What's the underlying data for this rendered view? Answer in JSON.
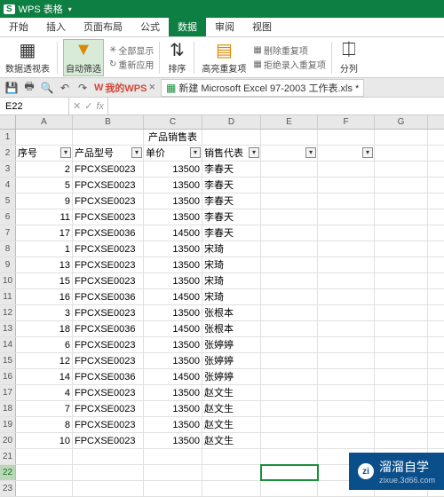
{
  "titlebar": {
    "badge": "S",
    "title": "WPS 表格"
  },
  "tabs": [
    "开始",
    "插入",
    "页面布局",
    "公式",
    "数据",
    "审阅",
    "视图"
  ],
  "active_tab": 4,
  "ribbon": {
    "pivot": "数据透视表",
    "autofilter": "自动筛选",
    "showall": "全部显示",
    "reapply": "重新应用",
    "sort": "排序",
    "highlight_dup": "高亮重复项",
    "remove_dup": "删除重复项",
    "reject_dup": "拒绝录入重复项",
    "split": "分列"
  },
  "qat": {
    "mywps": "我的WPS",
    "doc": "新建 Microsoft Excel 97-2003 工作表.xls *"
  },
  "namebox": "E22",
  "columns": [
    "A",
    "B",
    "C",
    "D",
    "E",
    "F",
    "G"
  ],
  "title_row": "产品销售表",
  "headers": [
    "序号",
    "产品型号",
    "单价",
    "销售代表"
  ],
  "rows": [
    {
      "n": 2,
      "model": "FPCXSE0023",
      "price": 13500,
      "rep": "李春天"
    },
    {
      "n": 5,
      "model": "FPCXSE0023",
      "price": 13500,
      "rep": "李春天"
    },
    {
      "n": 9,
      "model": "FPCXSE0023",
      "price": 13500,
      "rep": "李春天"
    },
    {
      "n": 11,
      "model": "FPCXSE0023",
      "price": 13500,
      "rep": "李春天"
    },
    {
      "n": 17,
      "model": "FPCXSE0036",
      "price": 14500,
      "rep": "李春天"
    },
    {
      "n": 1,
      "model": "FPCXSE0023",
      "price": 13500,
      "rep": "宋琦"
    },
    {
      "n": 13,
      "model": "FPCXSE0023",
      "price": 13500,
      "rep": "宋琦"
    },
    {
      "n": 15,
      "model": "FPCXSE0023",
      "price": 13500,
      "rep": "宋琦"
    },
    {
      "n": 16,
      "model": "FPCXSE0036",
      "price": 14500,
      "rep": "宋琦"
    },
    {
      "n": 3,
      "model": "FPCXSE0023",
      "price": 13500,
      "rep": "张根本"
    },
    {
      "n": 18,
      "model": "FPCXSE0036",
      "price": 14500,
      "rep": "张根本"
    },
    {
      "n": 6,
      "model": "FPCXSE0023",
      "price": 13500,
      "rep": "张婷婷"
    },
    {
      "n": 12,
      "model": "FPCXSE0023",
      "price": 13500,
      "rep": "张婷婷"
    },
    {
      "n": 14,
      "model": "FPCXSE0036",
      "price": 14500,
      "rep": "张婷婷"
    },
    {
      "n": 4,
      "model": "FPCXSE0023",
      "price": 13500,
      "rep": "赵文生"
    },
    {
      "n": 7,
      "model": "FPCXSE0023",
      "price": 13500,
      "rep": "赵文生"
    },
    {
      "n": 8,
      "model": "FPCXSE0023",
      "price": 13500,
      "rep": "赵文生"
    },
    {
      "n": 10,
      "model": "FPCXSE0023",
      "price": 13500,
      "rep": "赵文生"
    }
  ],
  "selected_row": 22,
  "row_labels": [
    1,
    2,
    3,
    4,
    5,
    6,
    7,
    8,
    9,
    10,
    11,
    12,
    13,
    14,
    15,
    16,
    17,
    18,
    19,
    20,
    21,
    22,
    23
  ],
  "watermark": {
    "brand": "溜溜自学",
    "sub": "zixue.3d66.com"
  }
}
